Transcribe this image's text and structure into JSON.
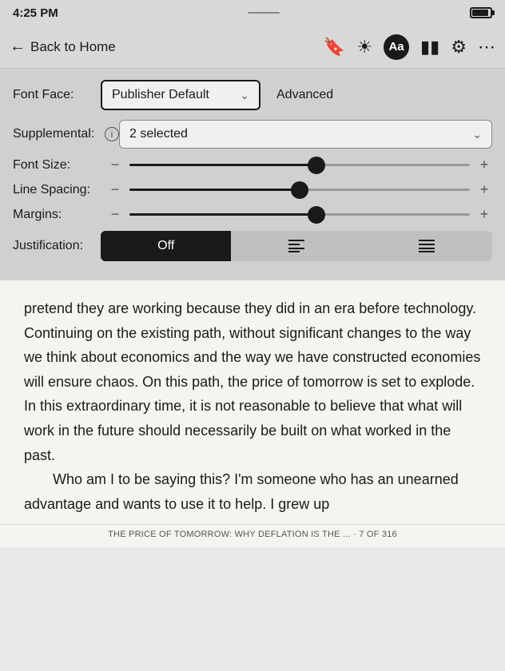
{
  "statusBar": {
    "time": "4:25 PM"
  },
  "navBar": {
    "backLabel": "Back to Home",
    "icons": {
      "bookmark": "🔖",
      "brightness": "☀",
      "aa": "Aa",
      "chart": "📊",
      "settings": "⚙",
      "more": "···"
    }
  },
  "settings": {
    "fontFaceLabel": "Font Face:",
    "fontFaceValue": "Publisher Default",
    "advancedLabel": "Advanced",
    "supplementalLabel": "Supplemental:",
    "supplementalValue": "2 selected",
    "fontSizeLabel": "Font Size:",
    "lineSpacingLabel": "Line Spacing:",
    "marginsLabel": "Margins:",
    "justificationLabel": "Justification:",
    "justificationButtons": [
      "Off",
      "≡",
      "≡"
    ],
    "sliders": {
      "fontSize": 0.55,
      "lineSpacing": 0.5,
      "margins": 0.55
    }
  },
  "content": {
    "paragraph1": "pretend they are working because they did in an era before technology. Continuing on the existing path, without significant changes to the way we think about economics and the way we have constructed economies will ensure chaos. On this path, the price of tomorrow is set to explode. In this extraordinary time, it is not reasonable to believe that what will work in the future should necessarily be built on what worked in the past.",
    "paragraph2": "Who am I to be saying this? I'm someone who has an unearned advantage and wants to use it to help. I grew up"
  },
  "footer": {
    "text": "THE PRICE OF TOMORROW: WHY DEFLATION IS THE ... · 7 OF 316"
  }
}
